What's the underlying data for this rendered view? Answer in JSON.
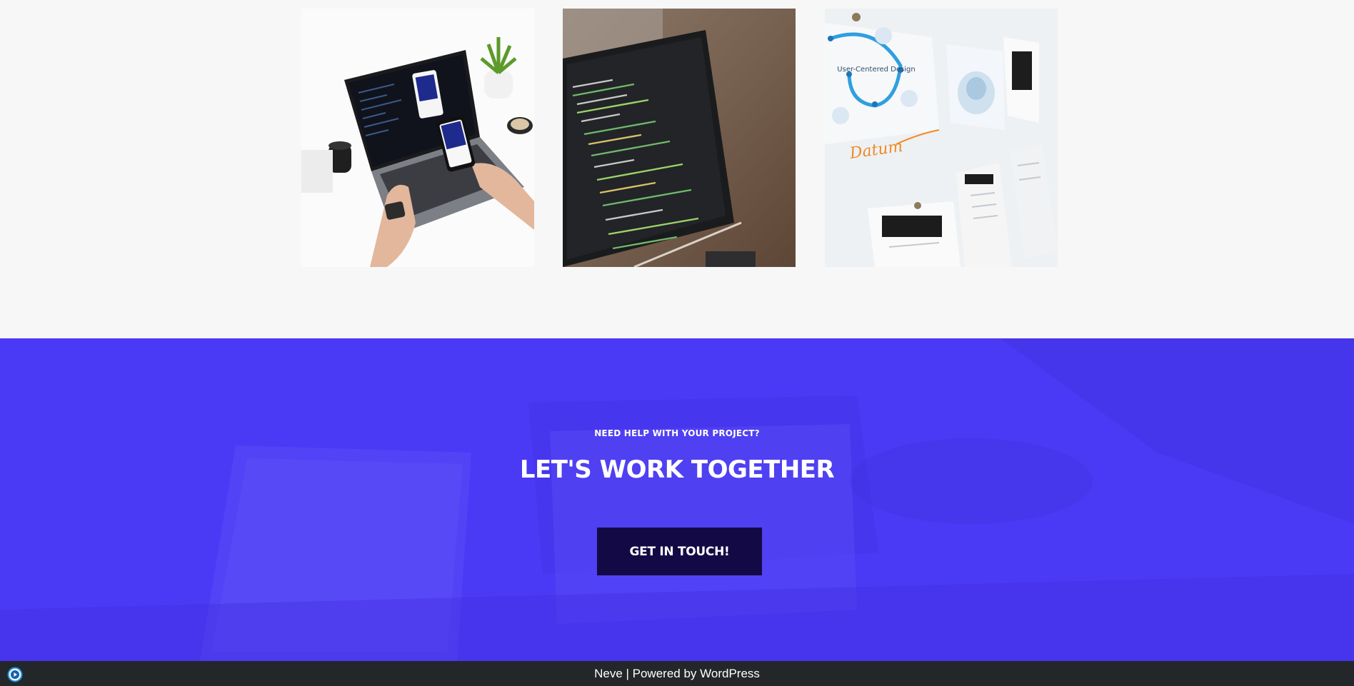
{
  "gallery": {
    "items": [
      {
        "alt": "laptop-with-phone-photo"
      },
      {
        "alt": "laptop-with-code-photo"
      },
      {
        "alt": "user-centered-design-wall-photo"
      }
    ],
    "diagram_text": "User-Centered Design",
    "handwriting": "Datum"
  },
  "cta": {
    "eyebrow": "NEED HELP WITH YOUR PROJECT?",
    "headline": "LET'S WORK TOGETHER",
    "button_label": "GET IN TOUCH!",
    "background_color": "#4a3af5",
    "button_color": "#130a45"
  },
  "footer": {
    "theme_link": "Neve",
    "separator": " | Powered by ",
    "platform_link": "WordPress",
    "background_color": "#23272a"
  },
  "icons": {
    "badge": "play-circle-icon"
  }
}
